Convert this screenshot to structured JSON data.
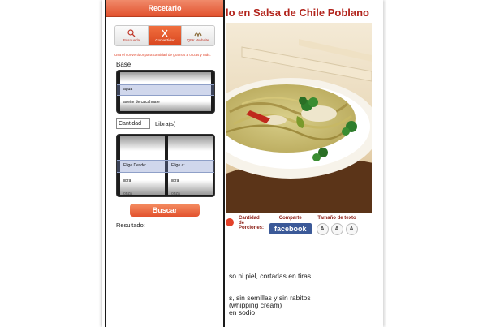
{
  "recipe": {
    "title": "lo en Salsa de Chile Poblano",
    "servings_label": "Cantidad de Porciones:",
    "share_label": "Comparte",
    "facebook_label": "facebook",
    "text_size_label": "Tamaño de texto",
    "text_size_buttons": [
      "A",
      "A",
      "A"
    ],
    "ingredients": [
      "so ni piel, cortadas en tiras",
      "",
      "",
      "s, sin semillas y sin rabitos",
      "(whipping cream)",
      "en sodio"
    ]
  },
  "panel": {
    "title": "Recetario",
    "tabs": [
      {
        "label": "Búsqueda",
        "icon": "search-icon"
      },
      {
        "label": "Convertidor",
        "icon": "utensils-icon"
      },
      {
        "label": "QFK Website",
        "icon": "website-icon"
      }
    ],
    "active_tab": 1,
    "hint": "Usa el convertidor para cantidad de gramos a onzas y más.",
    "base_label": "Base",
    "base_options": [
      "agua",
      "aceite de cacahuate"
    ],
    "quantity_placeholder": "Cantidad",
    "unit_label": "Libra(s)",
    "from_header": "Elige Desde:",
    "to_header": "Elige a:",
    "from_value": "libra",
    "to_value": "libra",
    "from_next": "onza",
    "to_next": "onza",
    "search_button": "Buscar",
    "result_label": "Resultado:"
  },
  "colors": {
    "accent": "#e2522e",
    "title_red": "#b2241c",
    "facebook": "#3b5998"
  }
}
